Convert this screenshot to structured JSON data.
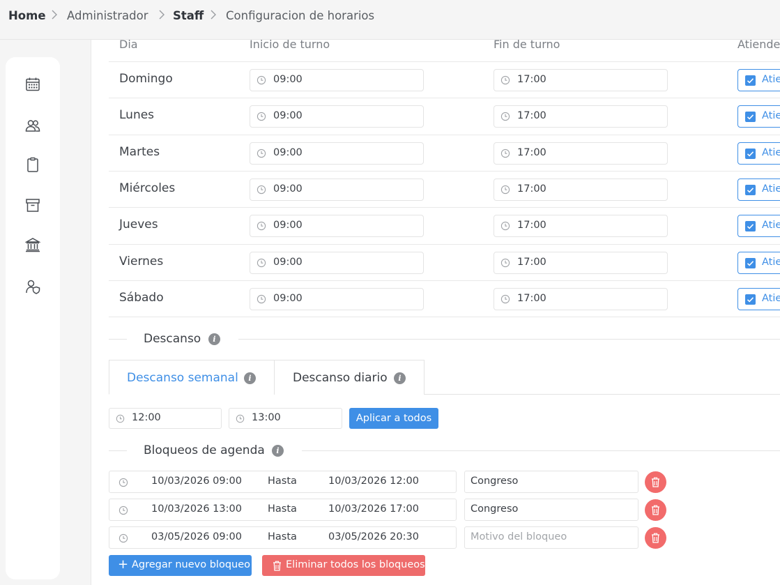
{
  "breadcrumb": {
    "home": "Home",
    "admin": "Administrador",
    "staff": "Staff",
    "current": "Configuracion de horarios"
  },
  "sidebar": {
    "icons": [
      "calendar-icon",
      "users-icon",
      "clipboard-icon",
      "archive-icon",
      "bank-icon",
      "user-shield-icon"
    ]
  },
  "table": {
    "headers": {
      "day": "Dia",
      "start": "Inicio de turno",
      "end": "Fin de turno",
      "attends": "Atiende"
    },
    "rows": [
      {
        "day": "Domingo",
        "start": "09:00",
        "end": "17:00",
        "attends_label": "Atiende",
        "checked": true
      },
      {
        "day": "Lunes",
        "start": "09:00",
        "end": "17:00",
        "attends_label": "Atiende",
        "checked": true
      },
      {
        "day": "Martes",
        "start": "09:00",
        "end": "17:00",
        "attends_label": "Atiende",
        "checked": true
      },
      {
        "day": "Miércoles",
        "start": "09:00",
        "end": "17:00",
        "attends_label": "Atiende",
        "checked": true
      },
      {
        "day": "Jueves",
        "start": "09:00",
        "end": "17:00",
        "attends_label": "Atiende",
        "checked": true
      },
      {
        "day": "Viernes",
        "start": "09:00",
        "end": "17:00",
        "attends_label": "Atiende",
        "checked": true
      },
      {
        "day": "Sábado",
        "start": "09:00",
        "end": "17:00",
        "attends_label": "Atiende",
        "checked": true
      }
    ]
  },
  "descanso": {
    "title": "Descanso",
    "tabs": [
      "Descanso semanal",
      "Descanso diario"
    ],
    "active_tab": "Descanso semanal",
    "start": "12:00",
    "end": "13:00",
    "apply_label": "Aplicar a todos"
  },
  "bloqueos": {
    "title": "Bloqueos de agenda",
    "hasta_label": "Hasta",
    "reason_placeholder": "Motivo del bloqueo",
    "items": [
      {
        "from": "10/03/2026 09:00",
        "to": "10/03/2026 12:00",
        "reason": "Congreso"
      },
      {
        "from": "10/03/2026 13:00",
        "to": "10/03/2026 17:00",
        "reason": "Congreso"
      },
      {
        "from": "03/05/2026 09:00",
        "to": "03/05/2026 20:30",
        "reason": ""
      }
    ],
    "add_label": "Agregar nuevo bloqueo",
    "delete_all_label": "Eliminar todos los bloqueos"
  },
  "colors": {
    "accent": "#3f8fe6",
    "danger": "#ee6b6b",
    "background": "#f5f5f5"
  }
}
